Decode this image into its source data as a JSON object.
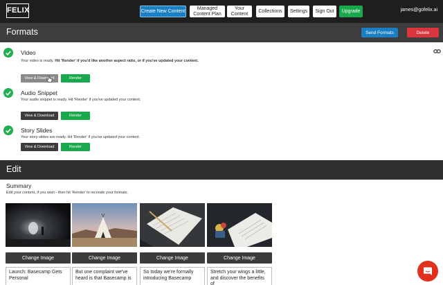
{
  "nav": {
    "logo": "FELIX",
    "items": [
      {
        "label": "Create New Content"
      },
      {
        "label": "Managed Content Plan"
      },
      {
        "label": "Your Content"
      },
      {
        "label": "Collections"
      },
      {
        "label": "Settings"
      },
      {
        "label": "Sign Out"
      },
      {
        "label": "Upgrade"
      }
    ],
    "email": "james@gofelix.ai"
  },
  "formats": {
    "title": "Formats",
    "send_label": "Send Formats",
    "delete_label": "Delete",
    "items": [
      {
        "title": "Video",
        "desc_plain": "Your video is ready. ",
        "desc_bold": "Hit 'Render' if you'd like another aspect ratio, or if you've updated your content.",
        "download_label": "View & Download",
        "render_label": "Render"
      },
      {
        "title": "Audio Snippet",
        "desc_plain": "Your audio snippet is ready. Hit 'Render' if you've updated your content.",
        "desc_bold": "",
        "download_label": "View & Download",
        "render_label": "Render"
      },
      {
        "title": "Story Slides",
        "desc_plain": "Your story slides are ready. Hit 'Render' if you've updated your content.",
        "desc_bold": "",
        "download_label": "View & Download",
        "render_label": "Render"
      }
    ],
    "icons": {
      "status": "check-circle-icon",
      "link": "link-icon",
      "cursor": "hand-cursor-icon"
    }
  },
  "edit": {
    "title": "Edit",
    "summary_title": "Summary",
    "summary_desc": "Edit your content, if you wish - then hit 'Render' to recreate your formats.",
    "cards": [
      {
        "image": "tunnel-photo",
        "change_label": "Change Image",
        "text": "Launch: Basecamp Gets Personal"
      },
      {
        "image": "tipi-photo",
        "change_label": "Change Image",
        "text": "But one complaint we've heard is that Basecamp is"
      },
      {
        "image": "notebook-photo",
        "change_label": "Change Image",
        "text": "So today we're formally introducing Basecamp"
      },
      {
        "image": "desk-photo",
        "change_label": "Change Image",
        "text": "Stretch your wings a little, and discover the benefits of"
      }
    ]
  },
  "chat": {
    "icon": "chat-bubble-icon"
  },
  "colors": {
    "accent_blue": "#1b7fc4",
    "success_green": "#19a84c",
    "danger_red": "#d9363e",
    "chat_red": "#e0301e"
  }
}
